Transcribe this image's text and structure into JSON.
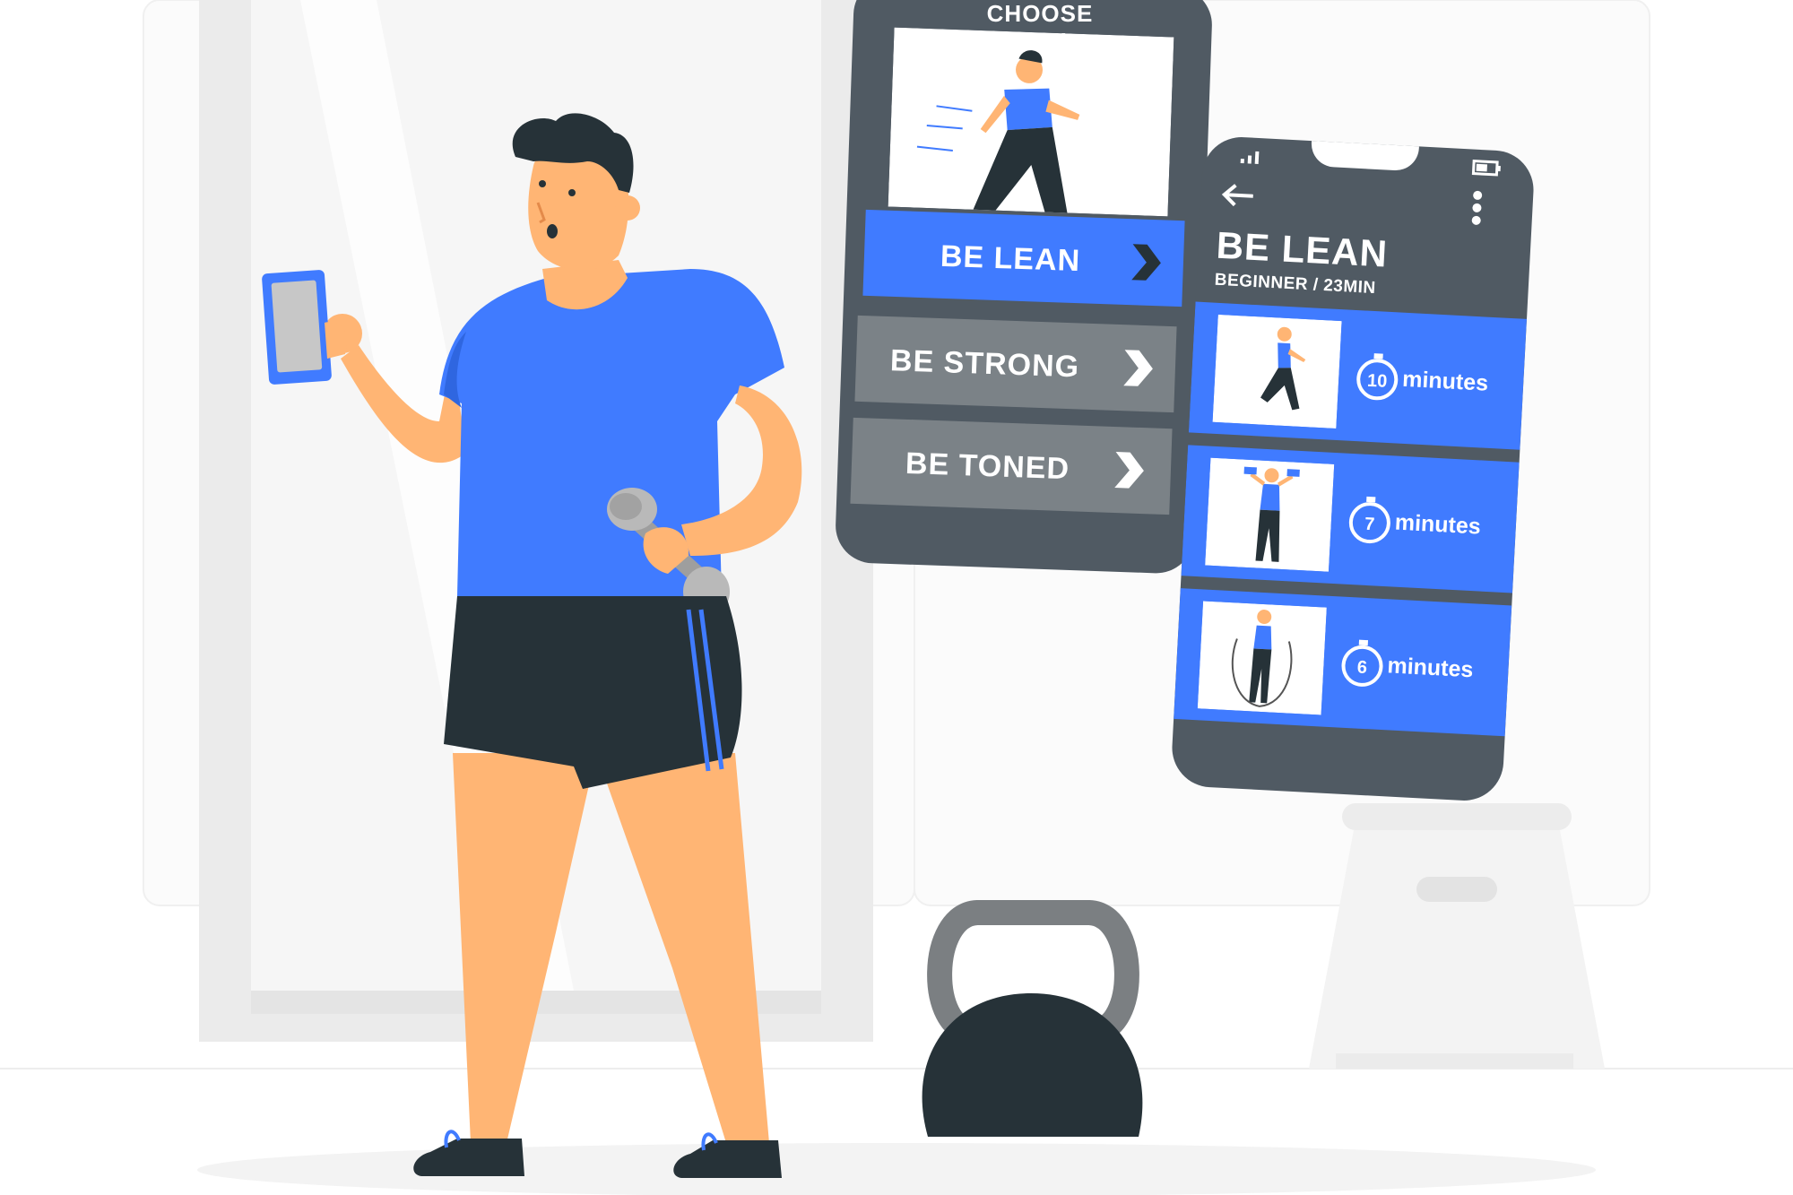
{
  "colors": {
    "brand_blue": "#407BFF",
    "phone_dark": "#505A63",
    "phone_light": "#7B8287",
    "skin": "#FFB574",
    "shorts": "#263238",
    "background_grey": "#F5F5F5"
  },
  "goal_phone": {
    "title": "CHOOSE GOAL",
    "options": [
      {
        "label": "BE LEAN",
        "icon": "chevron-right-icon",
        "selected": true
      },
      {
        "label": "BE STRONG",
        "icon": "chevron-right-icon",
        "selected": false
      },
      {
        "label": "BE TONED",
        "icon": "chevron-right-icon",
        "selected": false
      }
    ]
  },
  "workout_phone": {
    "icons": {
      "back": "arrow-left-icon",
      "menu": "kebab-menu-icon",
      "signal": "signal-icon",
      "battery": "battery-icon"
    },
    "title": "BE LEAN",
    "subtitle": "BEGINNER / 23MIN",
    "exercises": [
      {
        "minutes": "10",
        "unit": "minutes",
        "illustration": "running-figure"
      },
      {
        "minutes": "7",
        "unit": "minutes",
        "illustration": "dumbbell-press-figure"
      },
      {
        "minutes": "6",
        "unit": "minutes",
        "illustration": "jump-rope-figure"
      }
    ]
  }
}
